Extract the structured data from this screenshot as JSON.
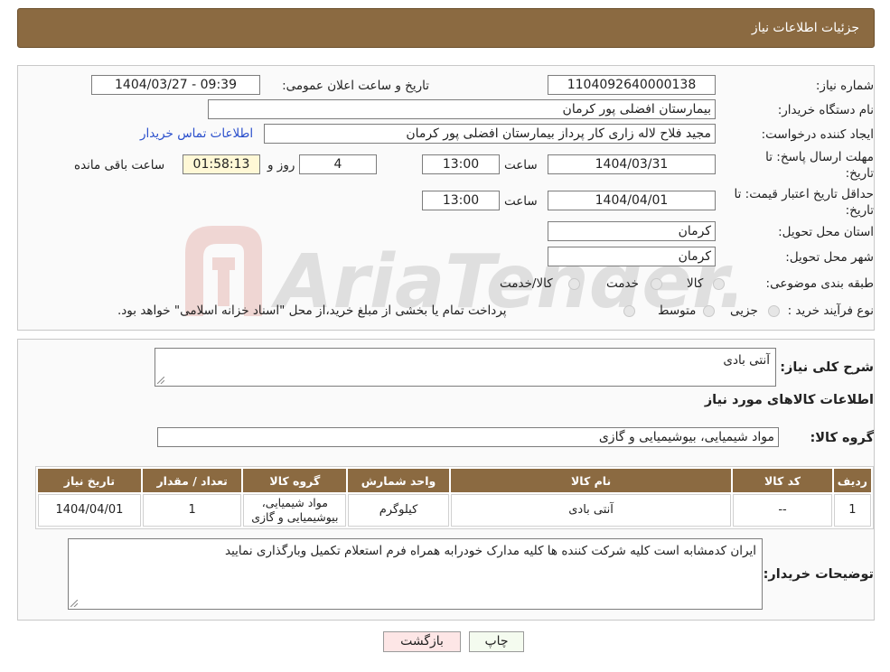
{
  "header": {
    "title": "جزئیات اطلاعات نیاز"
  },
  "watermark": {
    "text": "AriaTender.neT"
  },
  "info": {
    "need_number_label": "شماره نیاز:",
    "need_number": "1104092640000138",
    "announce_label": "تاریخ و ساعت اعلان عمومی:",
    "announce_value": "1404/03/27 - 09:39",
    "buyer_org_label": "نام دستگاه خریدار:",
    "buyer_org": "بیمارستان افضلی پور کرمان",
    "creator_label": "ایجاد کننده درخواست:",
    "creator": "مجید فلاح لاله زاری کار پرداز بیمارستان افضلی پور کرمان",
    "contact_link": "اطلاعات تماس خریدار",
    "deadline_label_1": "مهلت ارسال پاسخ: تا",
    "deadline_label_2": "تاریخ:",
    "deadline_date": "1404/03/31",
    "time_label": "ساعت",
    "deadline_time": "13:00",
    "days": "4",
    "days_label": "روز و",
    "remaining": "01:58:13",
    "remaining_label": "ساعت باقی مانده",
    "validity_label_1": "حداقل تاریخ اعتبار قیمت: تا",
    "validity_label_2": "تاریخ:",
    "validity_date": "1404/04/01",
    "validity_time": "13:00",
    "province_label": "استان محل تحویل:",
    "province": "کرمان",
    "city_label": "شهر محل تحویل:",
    "city": "کرمان",
    "category_label": "طبقه بندی موضوعی:",
    "category_options": [
      "کالا",
      "خدمت",
      "کالا/خدمت"
    ],
    "process_label": "نوع فرآیند خرید :",
    "process_options": [
      "جزیی",
      "متوسط"
    ],
    "process_note": "پرداخت تمام یا بخشی از مبلغ خرید،از محل \"اسناد خزانه اسلامی\" خواهد بود."
  },
  "details": {
    "general_desc_label": "شرح کلی نیاز:",
    "general_desc": "آنتی بادی",
    "goods_info_title": "اطلاعات کالاهای مورد نیاز",
    "goods_group_label": "گروه کالا:",
    "goods_group": "مواد شیمیایی، بیوشیمیایی و  گازی",
    "table": {
      "headers": [
        "ردیف",
        "کد کالا",
        "نام کالا",
        "واحد شمارش",
        "گروه کالا",
        "تعداد / مقدار",
        "تاریخ نیاز"
      ],
      "rows": [
        [
          "1",
          "--",
          "آنتی بادی",
          "کیلوگرم",
          "مواد شیمیایی، بیوشیمیایی و گازی",
          "1",
          "1404/04/01"
        ]
      ]
    },
    "buyer_notes_label": "توضیحات خریدار:",
    "buyer_notes": "ایران کدمشابه است کلیه شرکت کننده ها کلیه مدارک خودرابه همراه فرم استعلام تکمیل وبارگذاری نمایید"
  },
  "buttons": {
    "print": "چاپ",
    "back": "بازگشت"
  }
}
